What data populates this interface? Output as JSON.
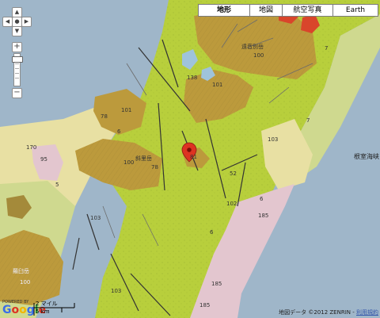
{
  "map_types": {
    "terrain": "地形",
    "map": "地図",
    "satellite": "航空写真",
    "earth": "Earth"
  },
  "zoom": {
    "level_fraction": 0.92
  },
  "unit_labels": {
    "u100a": "100",
    "u100b": "100",
    "u100c": "100",
    "u101a": "101",
    "u101b": "101",
    "u103a": "103",
    "u103b": "103",
    "u103c": "103",
    "u102": "102",
    "u78a": "78",
    "u78b": "78",
    "u95": "95",
    "u170": "170",
    "u5": "5",
    "u7a": "7",
    "u7b": "7",
    "u6a": "6",
    "u6b": "6",
    "u6c": "6",
    "u138": "138",
    "u185a": "185",
    "u185b": "185",
    "u185c": "185",
    "u81": "81",
    "u52": "52"
  },
  "places": {
    "nemuro_strait": "根室海峡"
  },
  "map_labels": {
    "shiretoko_dake": "遠音別岳",
    "shari_dake": "斜里岳",
    "rausu_dake": "羅臼岳"
  },
  "logo": {
    "powered_by": "POWERED BY",
    "name": "Google"
  },
  "scale": {
    "miles": "2 マイル",
    "km": "5 km"
  },
  "attribution": {
    "text": "地図データ ©2012 ZENRIN",
    "sep": " - ",
    "link": "利用規約"
  },
  "colors": {
    "sea": "#9fb6c9",
    "volcanic_green": "#b8cf3c",
    "lava_brown": "#bc9a3c",
    "light_green": "#cfd98f",
    "sediment_yellow": "#e8e0a3",
    "accretion_pink": "#e3c6cf",
    "lake": "#9fc3db",
    "red_unit": "#d9452b",
    "marker": "#dd3322"
  },
  "icons": {
    "pan_up": "arrow-up-icon",
    "pan_down": "arrow-down-icon",
    "pan_left": "arrow-left-icon",
    "pan_right": "arrow-right-icon",
    "pan_center": "center-icon",
    "zoom_in": "plus-icon",
    "zoom_out": "minus-icon",
    "marker": "map-pin-icon"
  }
}
